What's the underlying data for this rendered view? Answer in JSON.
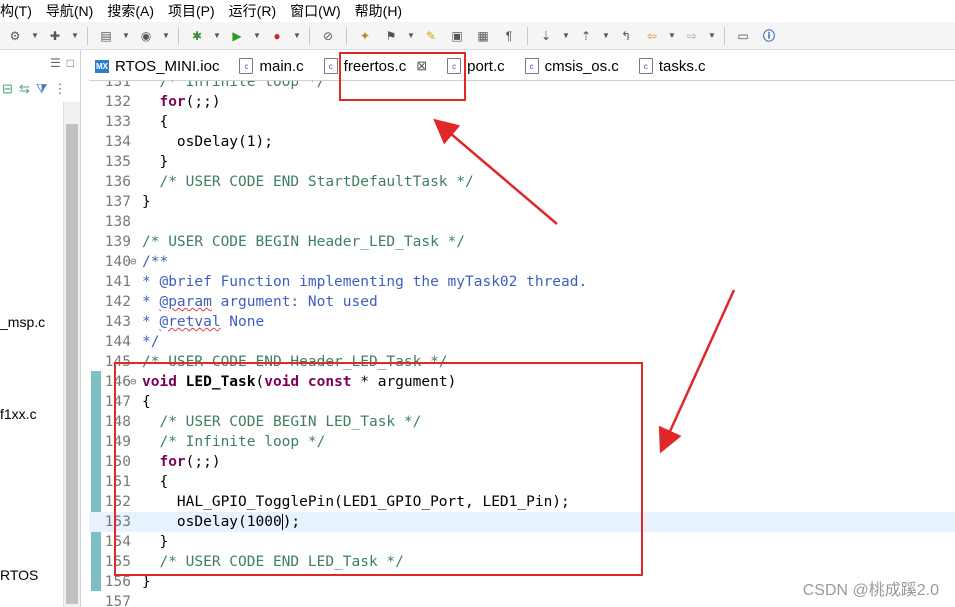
{
  "menubar": {
    "items": [
      "构(T)",
      "导航(N)",
      "搜索(A)",
      "项目(P)",
      "运行(R)",
      "窗口(W)",
      "帮助(H)"
    ]
  },
  "left_pane": {
    "items": [
      "_msp.c",
      "f1xx.c",
      "RTOS"
    ]
  },
  "tabs": [
    {
      "label": "RTOS_MINI.ioc",
      "icon": "mx-icon"
    },
    {
      "label": "main.c",
      "icon": "c-file-icon"
    },
    {
      "label": "freertos.c",
      "icon": "c-file-icon",
      "active": true,
      "close": "⊠"
    },
    {
      "label": "port.c",
      "icon": "c-file-icon"
    },
    {
      "label": "cmsis_os.c",
      "icon": "c-file-icon"
    },
    {
      "label": "tasks.c",
      "icon": "c-file-icon"
    }
  ],
  "editor": {
    "lines": [
      {
        "n": "131",
        "text": "  /* Infinite loop */"
      },
      {
        "n": "132",
        "text": "  for(;;)"
      },
      {
        "n": "133",
        "text": "  {"
      },
      {
        "n": "134",
        "text": "    osDelay(1);"
      },
      {
        "n": "135",
        "text": "  }"
      },
      {
        "n": "136",
        "text": "  /* USER CODE END StartDefaultTask */"
      },
      {
        "n": "137",
        "text": "}"
      },
      {
        "n": "138",
        "text": ""
      },
      {
        "n": "139",
        "text": "/* USER CODE BEGIN Header_LED_Task */"
      },
      {
        "n": "140",
        "text": "/**"
      },
      {
        "n": "141",
        "text": "* @brief Function implementing the myTask02 thread."
      },
      {
        "n": "142",
        "text": "* @param argument: Not used"
      },
      {
        "n": "143",
        "text": "* @retval None"
      },
      {
        "n": "144",
        "text": "*/"
      },
      {
        "n": "145",
        "text": "/* USER CODE END Header_LED_Task */"
      },
      {
        "n": "146",
        "text": "void LED_Task(void const * argument)"
      },
      {
        "n": "147",
        "text": "{"
      },
      {
        "n": "148",
        "text": "  /* USER CODE BEGIN LED_Task */"
      },
      {
        "n": "149",
        "text": "  /* Infinite loop */"
      },
      {
        "n": "150",
        "text": "  for(;;)"
      },
      {
        "n": "151",
        "text": "  {"
      },
      {
        "n": "152",
        "text": "    HAL_GPIO_TogglePin(LED1_GPIO_Port, LED1_Pin);"
      },
      {
        "n": "153",
        "text": "    osDelay(1000);"
      },
      {
        "n": "154",
        "text": "  }"
      },
      {
        "n": "155",
        "text": "  /* USER CODE END LED_Task */"
      },
      {
        "n": "156",
        "text": "}"
      },
      {
        "n": "157",
        "text": ""
      }
    ]
  },
  "watermark": "CSDN @桃成蹊2.0",
  "colors": {
    "keyword": "#7f0055",
    "comment": "#3f7f5f",
    "javadoc": "#3f5fbf",
    "annotation_box": "#e02828"
  }
}
